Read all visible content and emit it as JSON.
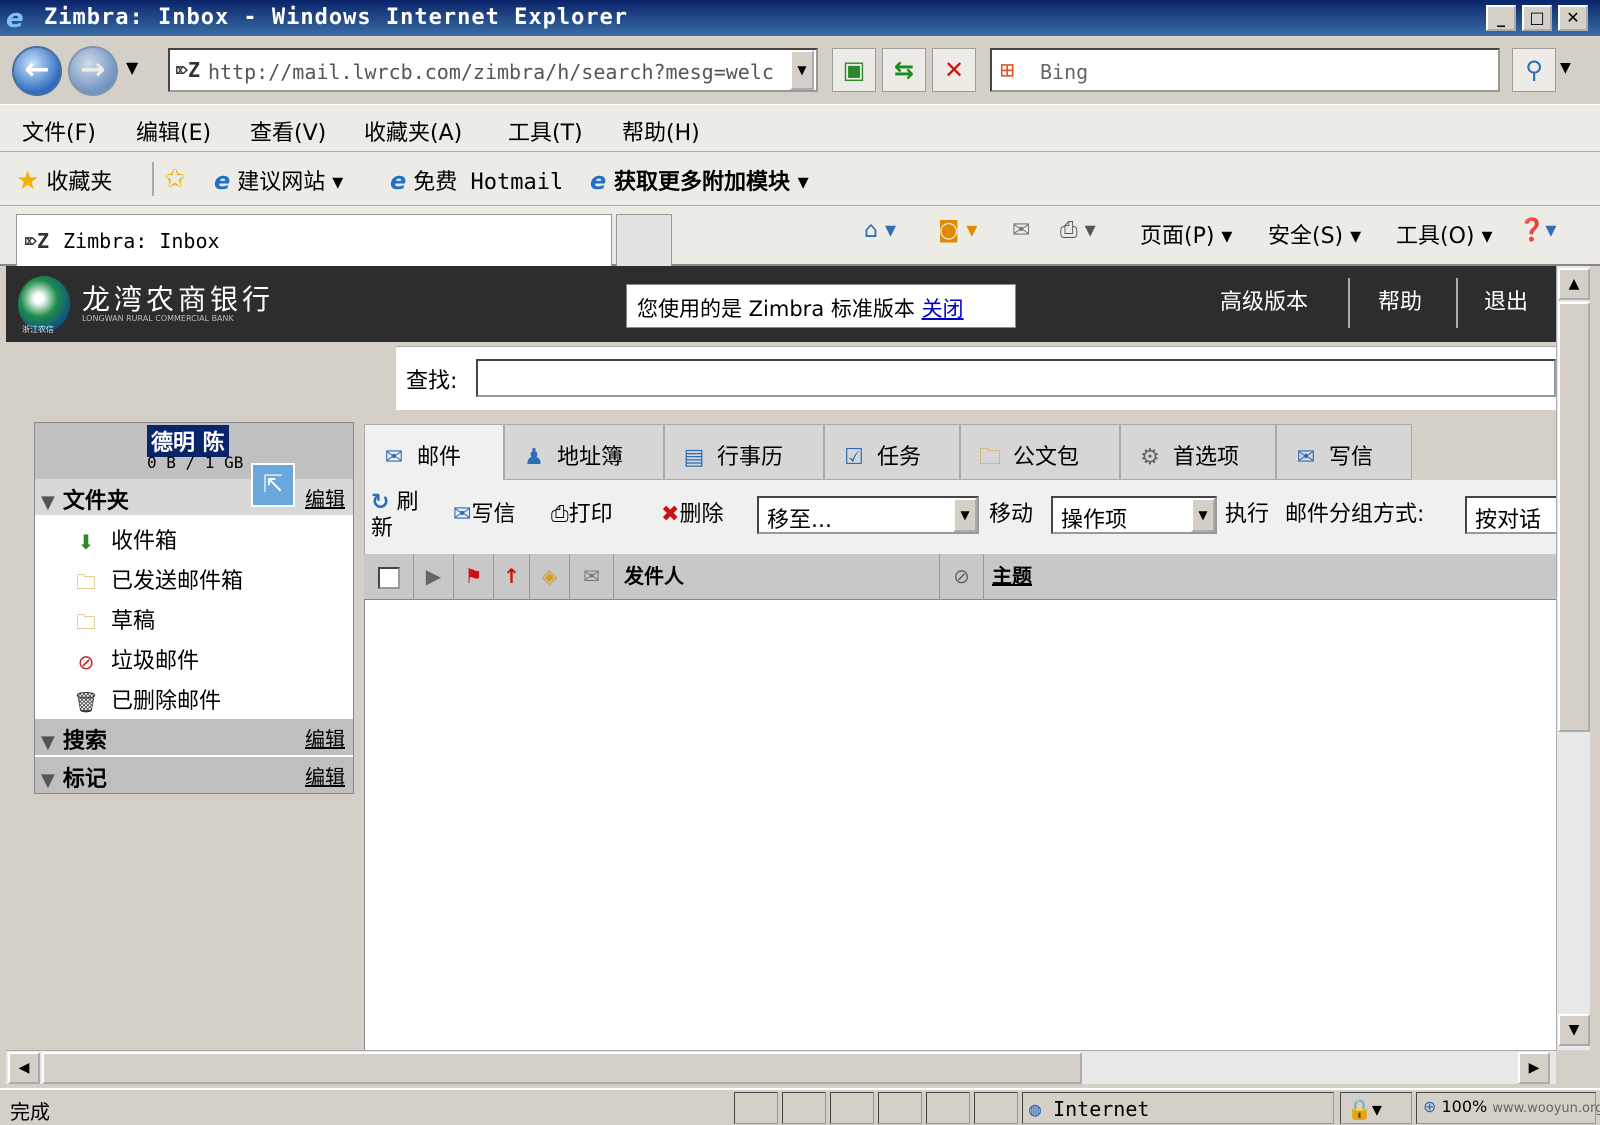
{
  "window": {
    "title": "Zimbra: Inbox - Windows Internet Explorer",
    "controls": [
      "_",
      "□",
      "✕"
    ]
  },
  "address": {
    "url": "http://mail.lwrcb.com/zimbra/h/search?mesg=welc",
    "search_provider": "Bing"
  },
  "menu": [
    "文件(F)",
    "编辑(E)",
    "查看(V)",
    "收藏夹(A)",
    "工具(T)",
    "帮助(H)"
  ],
  "favorites": {
    "label": "收藏夹",
    "items": [
      "建议网站 ▾",
      "免费 Hotmail",
      "获取更多附加模块 ▾"
    ]
  },
  "tab": {
    "title": "Zimbra: Inbox"
  },
  "commandbar": [
    "页面(P) ▾",
    "安全(S) ▾",
    "工具(O) ▾"
  ],
  "header": {
    "bank_name": "龙湾农商银行",
    "bank_name_en": "LONGWAN RURAL COMMERCIAL BANK",
    "logo_sub": "浙江农信",
    "notice_text": "您使用的是 Zimbra 标准版本",
    "notice_link": "关闭",
    "links": [
      "高级版本",
      "帮助",
      "退出"
    ]
  },
  "search": {
    "label": "查找:"
  },
  "user": {
    "name": "德明 陈",
    "quota": "0 B / 1 GB"
  },
  "sidebar": {
    "folders_label": "文件夹",
    "edit_label": "编辑",
    "folders": [
      "收件箱",
      "已发送邮件箱",
      "草稿",
      "垃圾邮件",
      "已删除邮件"
    ],
    "search_label": "搜索",
    "tags_label": "标记"
  },
  "apptabs": [
    "邮件",
    "地址簿",
    "行事历",
    "任务",
    "公文包",
    "首选项",
    "写信"
  ],
  "toolbar": {
    "refresh": "刷新",
    "compose": "写信",
    "print": "打印",
    "delete": "删除",
    "moveto": "移至...",
    "move": "移动",
    "actions": "操作项",
    "execute": "执行",
    "groupby_label": "邮件分组方式:",
    "groupby_value": "按对话"
  },
  "list": {
    "col_sender": "发件人",
    "col_subject": "主题"
  },
  "status": {
    "text": "完成",
    "zone": "Internet",
    "zoom": "100%",
    "watermark": "www.wooyun.org"
  }
}
